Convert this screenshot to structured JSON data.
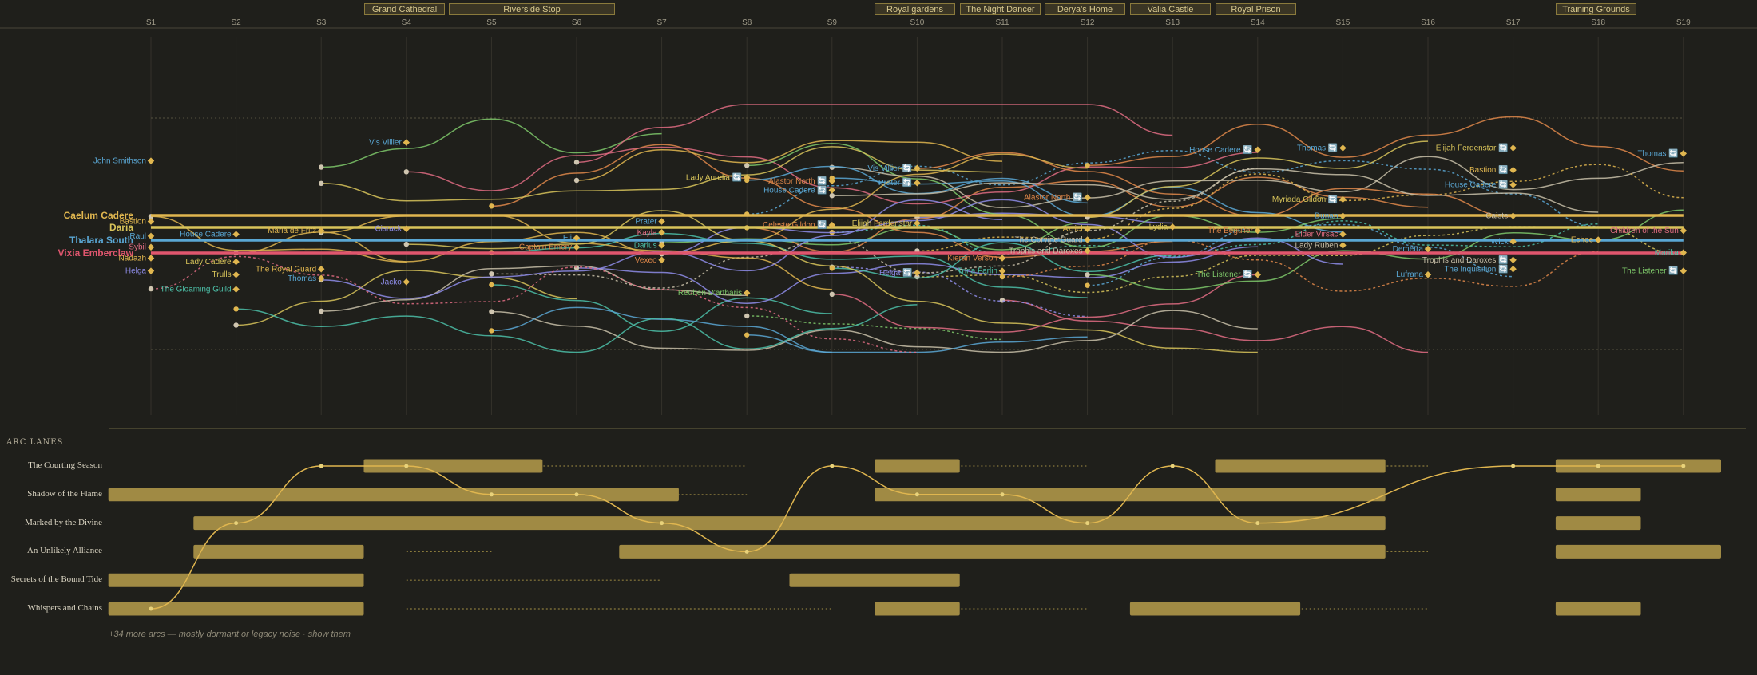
{
  "sessions": [
    "S1",
    "S2",
    "S3",
    "S4",
    "S5",
    "S6",
    "S7",
    "S8",
    "S9",
    "S10",
    "S11",
    "S12",
    "S13",
    "S14",
    "S15",
    "S16",
    "S17",
    "S18",
    "S19"
  ],
  "locations": [
    {
      "label": "Grand Cathedral",
      "from": 3.5,
      "to": 4.45
    },
    {
      "label": "Riverside Stop",
      "from": 4.5,
      "to": 6.45
    },
    {
      "label": "Royal gardens",
      "from": 9.5,
      "to": 10.45
    },
    {
      "label": "The Night Dancer",
      "from": 10.5,
      "to": 11.45
    },
    {
      "label": "Derya's Home",
      "from": 11.5,
      "to": 12.45
    },
    {
      "label": "Valia Castle",
      "from": 12.5,
      "to": 13.45
    },
    {
      "label": "Royal Prison",
      "from": 13.5,
      "to": 14.45
    },
    {
      "label": "Training Grounds",
      "from": 17.5,
      "to": 18.45
    }
  ],
  "colors": {
    "gold": "#e0b64f",
    "yellow": "#d8c45a",
    "cream": "#e8dba6",
    "blue": "#5aa7d4",
    "red": "#e0566e",
    "green": "#7ec86a",
    "purple": "#8e8ce8",
    "orange": "#e0884a",
    "pink": "#e06c82",
    "teal": "#4cc0a8",
    "beige": "#c8bfa8"
  },
  "main_characters": [
    {
      "name": "Caelum Cadere",
      "color": "#e0b64f",
      "session": 1,
      "lane": 0
    },
    {
      "name": "Daria",
      "color": "#d8c45a",
      "session": 1,
      "lane": 1
    },
    {
      "name": "Thalara South",
      "color": "#5aa7d4",
      "session": 1,
      "lane": 2
    },
    {
      "name": "Vixia Emberclaw",
      "color": "#e0566e",
      "session": 1,
      "lane": 3
    }
  ],
  "character_labels": [
    {
      "name": "John Smithson",
      "color": "#5aa7d4",
      "session": 1,
      "y": 0.02
    },
    {
      "name": "Bastion",
      "color": "#e0b64f",
      "session": 1,
      "y": 0.35
    },
    {
      "name": "Raul",
      "color": "#5aa7d4",
      "session": 1,
      "y": 0.43
    },
    {
      "name": "Sybil",
      "color": "#e06c82",
      "session": 1,
      "y": 0.49
    },
    {
      "name": "Nadazh",
      "color": "#e0b64f",
      "session": 1,
      "y": 0.55
    },
    {
      "name": "Helga",
      "color": "#8e8ce8",
      "session": 1,
      "y": 0.62
    },
    {
      "name": "Vis Villier",
      "color": "#5aa7d4",
      "session": 4,
      "y": -0.08
    },
    {
      "name": "House Cadere",
      "color": "#5aa7d4",
      "session": 2,
      "y": 0.42
    },
    {
      "name": "Maria de Fritz",
      "color": "#e0b64f",
      "session": 3,
      "y": 0.4
    },
    {
      "name": "Lady Cadere",
      "color": "#d8c45a",
      "session": 2,
      "y": 0.57
    },
    {
      "name": "The Royal Guard",
      "color": "#e0b64f",
      "session": 3,
      "y": 0.61
    },
    {
      "name": "Trulls",
      "color": "#d8c45a",
      "session": 2,
      "y": 0.64
    },
    {
      "name": "Thomas",
      "color": "#5aa7d4",
      "session": 3,
      "y": 0.66
    },
    {
      "name": "The Gloaming Guild",
      "color": "#4cc0a8",
      "session": 2,
      "y": 0.72
    },
    {
      "name": "Cisrack",
      "color": "#8e8ce8",
      "session": 4,
      "y": 0.39
    },
    {
      "name": "Jacko",
      "color": "#8e8ce8",
      "session": 4,
      "y": 0.68
    },
    {
      "name": "Eli",
      "color": "#5aa7d4",
      "session": 6,
      "y": 0.44
    },
    {
      "name": "Captain Emery",
      "color": "#e0884a",
      "session": 6,
      "y": 0.49
    },
    {
      "name": "Lady Aurelia 🔄",
      "color": "#d8c45a",
      "session": 8,
      "y": 0.11
    },
    {
      "name": "Prater",
      "color": "#5aa7d4",
      "session": 7,
      "y": 0.35
    },
    {
      "name": "Kayla",
      "color": "#e06c82",
      "session": 7,
      "y": 0.41
    },
    {
      "name": "Darius",
      "color": "#4cc0a8",
      "session": 7,
      "y": 0.48
    },
    {
      "name": "Vexeo",
      "color": "#e0884a",
      "session": 7,
      "y": 0.56
    },
    {
      "name": "Reuben D'artharis",
      "color": "#7ec86a",
      "session": 8,
      "y": 0.74
    },
    {
      "name": "Alastor North 🔄",
      "color": "#e0884a",
      "session": 9,
      "y": 0.13
    },
    {
      "name": "House Cadere 🔄",
      "color": "#5aa7d4",
      "session": 9,
      "y": 0.18
    },
    {
      "name": "Celeste Gildon 🔄",
      "color": "#e0884a",
      "session": 9,
      "y": 0.37
    },
    {
      "name": "Elijah Ferdenstar",
      "color": "#d8c45a",
      "session": 10,
      "y": 0.36
    },
    {
      "name": "Vis Villier 🔄",
      "color": "#5aa7d4",
      "session": 10,
      "y": 0.06
    },
    {
      "name": "Prater 🔄",
      "color": "#5aa7d4",
      "session": 10,
      "y": 0.14
    },
    {
      "name": "Helga 🔄",
      "color": "#8e8ce8",
      "session": 10,
      "y": 0.63
    },
    {
      "name": "Kieran Verson",
      "color": "#e0884a",
      "session": 11,
      "y": 0.55
    },
    {
      "name": "Trina Farlin",
      "color": "#4cc0a8",
      "session": 11,
      "y": 0.62
    },
    {
      "name": "Alastor North 🔄",
      "color": "#e0884a",
      "session": 12,
      "y": 0.22
    },
    {
      "name": "The Corvine Guard",
      "color": "#c8bfa8",
      "session": 12,
      "y": 0.45
    },
    {
      "name": "Trophis and Daroxes",
      "color": "#c8bfa8",
      "session": 12,
      "y": 0.51
    },
    {
      "name": "Azriel",
      "color": "#e0b64f",
      "session": 12,
      "y": 0.39
    },
    {
      "name": "Lydia",
      "color": "#d8c45a",
      "session": 13,
      "y": 0.38
    },
    {
      "name": "House Cadere 🔄",
      "color": "#5aa7d4",
      "session": 14,
      "y": -0.04
    },
    {
      "name": "The Beguiler",
      "color": "#e0884a",
      "session": 14,
      "y": 0.4
    },
    {
      "name": "The Listener 🔄",
      "color": "#7ec86a",
      "session": 14,
      "y": 0.64
    },
    {
      "name": "Myriada Gildon 🔄",
      "color": "#d8c45a",
      "session": 15,
      "y": 0.23
    },
    {
      "name": "Dunan",
      "color": "#5aa7d4",
      "session": 15,
      "y": 0.32
    },
    {
      "name": "Elder Virsac",
      "color": "#e06c82",
      "session": 15,
      "y": 0.42
    },
    {
      "name": "Lady Ruben",
      "color": "#c8bfa8",
      "session": 15,
      "y": 0.48
    },
    {
      "name": "Thomas 🔄",
      "color": "#5aa7d4",
      "session": 15,
      "y": -0.05
    },
    {
      "name": "Demetra",
      "color": "#5aa7d4",
      "session": 16,
      "y": 0.5
    },
    {
      "name": "Lufrana",
      "color": "#5aa7d4",
      "session": 16,
      "y": 0.64
    },
    {
      "name": "Elijah Ferdenstar 🔄",
      "color": "#d8c45a",
      "session": 17,
      "y": -0.05
    },
    {
      "name": "Bastion 🔄",
      "color": "#e0b64f",
      "session": 17,
      "y": 0.07
    },
    {
      "name": "House Cadere 🔄",
      "color": "#5aa7d4",
      "session": 17,
      "y": 0.15
    },
    {
      "name": "Trophis and Daroxes 🔄",
      "color": "#c8bfa8",
      "session": 17,
      "y": 0.56
    },
    {
      "name": "The Inquisition 🔄",
      "color": "#5aa7d4",
      "session": 17,
      "y": 0.61
    },
    {
      "name": "Caiste",
      "color": "#c8bfa8",
      "session": 17,
      "y": 0.32
    },
    {
      "name": "Wick",
      "color": "#5aa7d4",
      "session": 17,
      "y": 0.46
    },
    {
      "name": "Echoe",
      "color": "#e0b64f",
      "session": 18,
      "y": 0.45
    },
    {
      "name": "Children of the Sun",
      "color": "#e06c82",
      "session": 19,
      "y": 0.4
    },
    {
      "name": "Thomas 🔄",
      "color": "#5aa7d4",
      "session": 19,
      "y": -0.02
    },
    {
      "name": "Marika",
      "color": "#4cc0a8",
      "session": 19,
      "y": 0.52
    },
    {
      "name": "The Listener 🔄",
      "color": "#7ec86a",
      "session": 19,
      "y": 0.62
    }
  ],
  "arc_lanes_title": "ARC LANES",
  "arcs": [
    {
      "name": "The Courting Season",
      "bars": [
        [
          3.5,
          5.6
        ],
        [
          9.5,
          10.5
        ],
        [
          13.5,
          15.5
        ],
        [
          17.5,
          20.5
        ]
      ],
      "dotted": [
        [
          5.0,
          8.0
        ],
        [
          10.0,
          12.0
        ],
        [
          15.0,
          16.0
        ]
      ]
    },
    {
      "name": "Shadow of the Flame",
      "bars": [
        [
          0.5,
          7.2
        ],
        [
          9.5,
          15.5
        ],
        [
          17.5,
          18.5
        ]
      ],
      "dotted": [
        [
          7.0,
          8.0
        ]
      ]
    },
    {
      "name": "Marked by the Divine",
      "bars": [
        [
          1.5,
          15.5
        ],
        [
          17.5,
          18.5
        ]
      ],
      "dotted": []
    },
    {
      "name": "An Unlikely Alliance",
      "bars": [
        [
          1.5,
          3.5
        ],
        [
          6.5,
          15.5
        ],
        [
          17.5,
          20.5
        ]
      ],
      "dotted": [
        [
          4.0,
          5.0
        ],
        [
          15.0,
          16.0
        ]
      ]
    },
    {
      "name": "Secrets of the Bound Tide",
      "bars": [
        [
          0.5,
          3.5
        ],
        [
          8.5,
          10.5
        ]
      ],
      "dotted": [
        [
          4.0,
          7.0
        ]
      ]
    },
    {
      "name": "Whispers and Chains",
      "bars": [
        [
          0.5,
          3.5
        ],
        [
          9.5,
          10.5
        ],
        [
          12.5,
          14.5
        ],
        [
          17.5,
          18.5
        ]
      ],
      "dotted": [
        [
          4.0,
          9.0
        ],
        [
          10.0,
          12.0
        ],
        [
          14.0,
          16.0
        ]
      ]
    }
  ],
  "arc_path": [
    [
      1,
      5
    ],
    [
      2,
      2
    ],
    [
      3,
      0
    ],
    [
      4,
      0
    ],
    [
      5,
      1
    ],
    [
      6,
      1
    ],
    [
      7,
      2
    ],
    [
      8,
      3
    ],
    [
      9,
      0
    ],
    [
      10,
      1
    ],
    [
      11,
      1
    ],
    [
      12,
      2
    ],
    [
      13,
      0
    ],
    [
      14,
      2
    ],
    [
      17,
      0
    ],
    [
      18,
      0
    ],
    [
      19,
      0
    ]
  ],
  "footer_note": "+34 more arcs — mostly dormant or legacy noise · show them"
}
